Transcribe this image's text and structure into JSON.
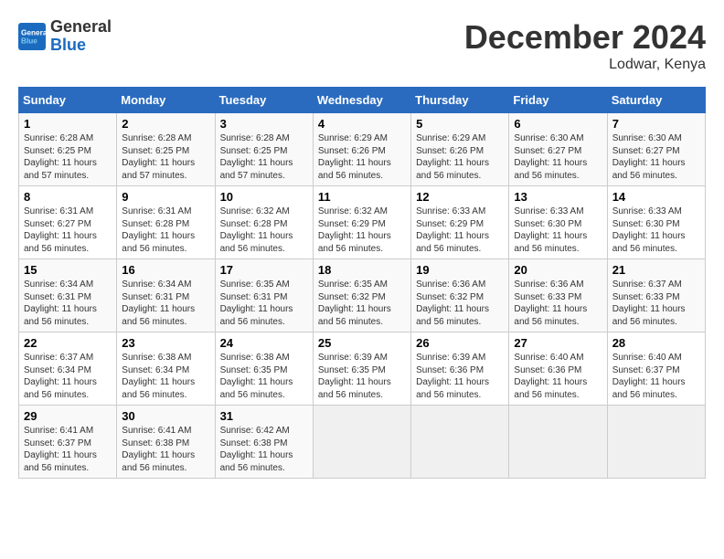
{
  "logo": {
    "line1": "General",
    "line2": "Blue"
  },
  "title": "December 2024",
  "location": "Lodwar, Kenya",
  "days_of_week": [
    "Sunday",
    "Monday",
    "Tuesday",
    "Wednesday",
    "Thursday",
    "Friday",
    "Saturday"
  ],
  "weeks": [
    [
      {
        "day": "1",
        "info": "Sunrise: 6:28 AM\nSunset: 6:25 PM\nDaylight: 11 hours\nand 57 minutes."
      },
      {
        "day": "2",
        "info": "Sunrise: 6:28 AM\nSunset: 6:25 PM\nDaylight: 11 hours\nand 57 minutes."
      },
      {
        "day": "3",
        "info": "Sunrise: 6:28 AM\nSunset: 6:25 PM\nDaylight: 11 hours\nand 57 minutes."
      },
      {
        "day": "4",
        "info": "Sunrise: 6:29 AM\nSunset: 6:26 PM\nDaylight: 11 hours\nand 56 minutes."
      },
      {
        "day": "5",
        "info": "Sunrise: 6:29 AM\nSunset: 6:26 PM\nDaylight: 11 hours\nand 56 minutes."
      },
      {
        "day": "6",
        "info": "Sunrise: 6:30 AM\nSunset: 6:27 PM\nDaylight: 11 hours\nand 56 minutes."
      },
      {
        "day": "7",
        "info": "Sunrise: 6:30 AM\nSunset: 6:27 PM\nDaylight: 11 hours\nand 56 minutes."
      }
    ],
    [
      {
        "day": "8",
        "info": "Sunrise: 6:31 AM\nSunset: 6:27 PM\nDaylight: 11 hours\nand 56 minutes."
      },
      {
        "day": "9",
        "info": "Sunrise: 6:31 AM\nSunset: 6:28 PM\nDaylight: 11 hours\nand 56 minutes."
      },
      {
        "day": "10",
        "info": "Sunrise: 6:32 AM\nSunset: 6:28 PM\nDaylight: 11 hours\nand 56 minutes."
      },
      {
        "day": "11",
        "info": "Sunrise: 6:32 AM\nSunset: 6:29 PM\nDaylight: 11 hours\nand 56 minutes."
      },
      {
        "day": "12",
        "info": "Sunrise: 6:33 AM\nSunset: 6:29 PM\nDaylight: 11 hours\nand 56 minutes."
      },
      {
        "day": "13",
        "info": "Sunrise: 6:33 AM\nSunset: 6:30 PM\nDaylight: 11 hours\nand 56 minutes."
      },
      {
        "day": "14",
        "info": "Sunrise: 6:33 AM\nSunset: 6:30 PM\nDaylight: 11 hours\nand 56 minutes."
      }
    ],
    [
      {
        "day": "15",
        "info": "Sunrise: 6:34 AM\nSunset: 6:31 PM\nDaylight: 11 hours\nand 56 minutes."
      },
      {
        "day": "16",
        "info": "Sunrise: 6:34 AM\nSunset: 6:31 PM\nDaylight: 11 hours\nand 56 minutes."
      },
      {
        "day": "17",
        "info": "Sunrise: 6:35 AM\nSunset: 6:31 PM\nDaylight: 11 hours\nand 56 minutes."
      },
      {
        "day": "18",
        "info": "Sunrise: 6:35 AM\nSunset: 6:32 PM\nDaylight: 11 hours\nand 56 minutes."
      },
      {
        "day": "19",
        "info": "Sunrise: 6:36 AM\nSunset: 6:32 PM\nDaylight: 11 hours\nand 56 minutes."
      },
      {
        "day": "20",
        "info": "Sunrise: 6:36 AM\nSunset: 6:33 PM\nDaylight: 11 hours\nand 56 minutes."
      },
      {
        "day": "21",
        "info": "Sunrise: 6:37 AM\nSunset: 6:33 PM\nDaylight: 11 hours\nand 56 minutes."
      }
    ],
    [
      {
        "day": "22",
        "info": "Sunrise: 6:37 AM\nSunset: 6:34 PM\nDaylight: 11 hours\nand 56 minutes."
      },
      {
        "day": "23",
        "info": "Sunrise: 6:38 AM\nSunset: 6:34 PM\nDaylight: 11 hours\nand 56 minutes."
      },
      {
        "day": "24",
        "info": "Sunrise: 6:38 AM\nSunset: 6:35 PM\nDaylight: 11 hours\nand 56 minutes."
      },
      {
        "day": "25",
        "info": "Sunrise: 6:39 AM\nSunset: 6:35 PM\nDaylight: 11 hours\nand 56 minutes."
      },
      {
        "day": "26",
        "info": "Sunrise: 6:39 AM\nSunset: 6:36 PM\nDaylight: 11 hours\nand 56 minutes."
      },
      {
        "day": "27",
        "info": "Sunrise: 6:40 AM\nSunset: 6:36 PM\nDaylight: 11 hours\nand 56 minutes."
      },
      {
        "day": "28",
        "info": "Sunrise: 6:40 AM\nSunset: 6:37 PM\nDaylight: 11 hours\nand 56 minutes."
      }
    ],
    [
      {
        "day": "29",
        "info": "Sunrise: 6:41 AM\nSunset: 6:37 PM\nDaylight: 11 hours\nand 56 minutes."
      },
      {
        "day": "30",
        "info": "Sunrise: 6:41 AM\nSunset: 6:38 PM\nDaylight: 11 hours\nand 56 minutes."
      },
      {
        "day": "31",
        "info": "Sunrise: 6:42 AM\nSunset: 6:38 PM\nDaylight: 11 hours\nand 56 minutes."
      },
      {
        "day": "",
        "info": ""
      },
      {
        "day": "",
        "info": ""
      },
      {
        "day": "",
        "info": ""
      },
      {
        "day": "",
        "info": ""
      }
    ]
  ]
}
